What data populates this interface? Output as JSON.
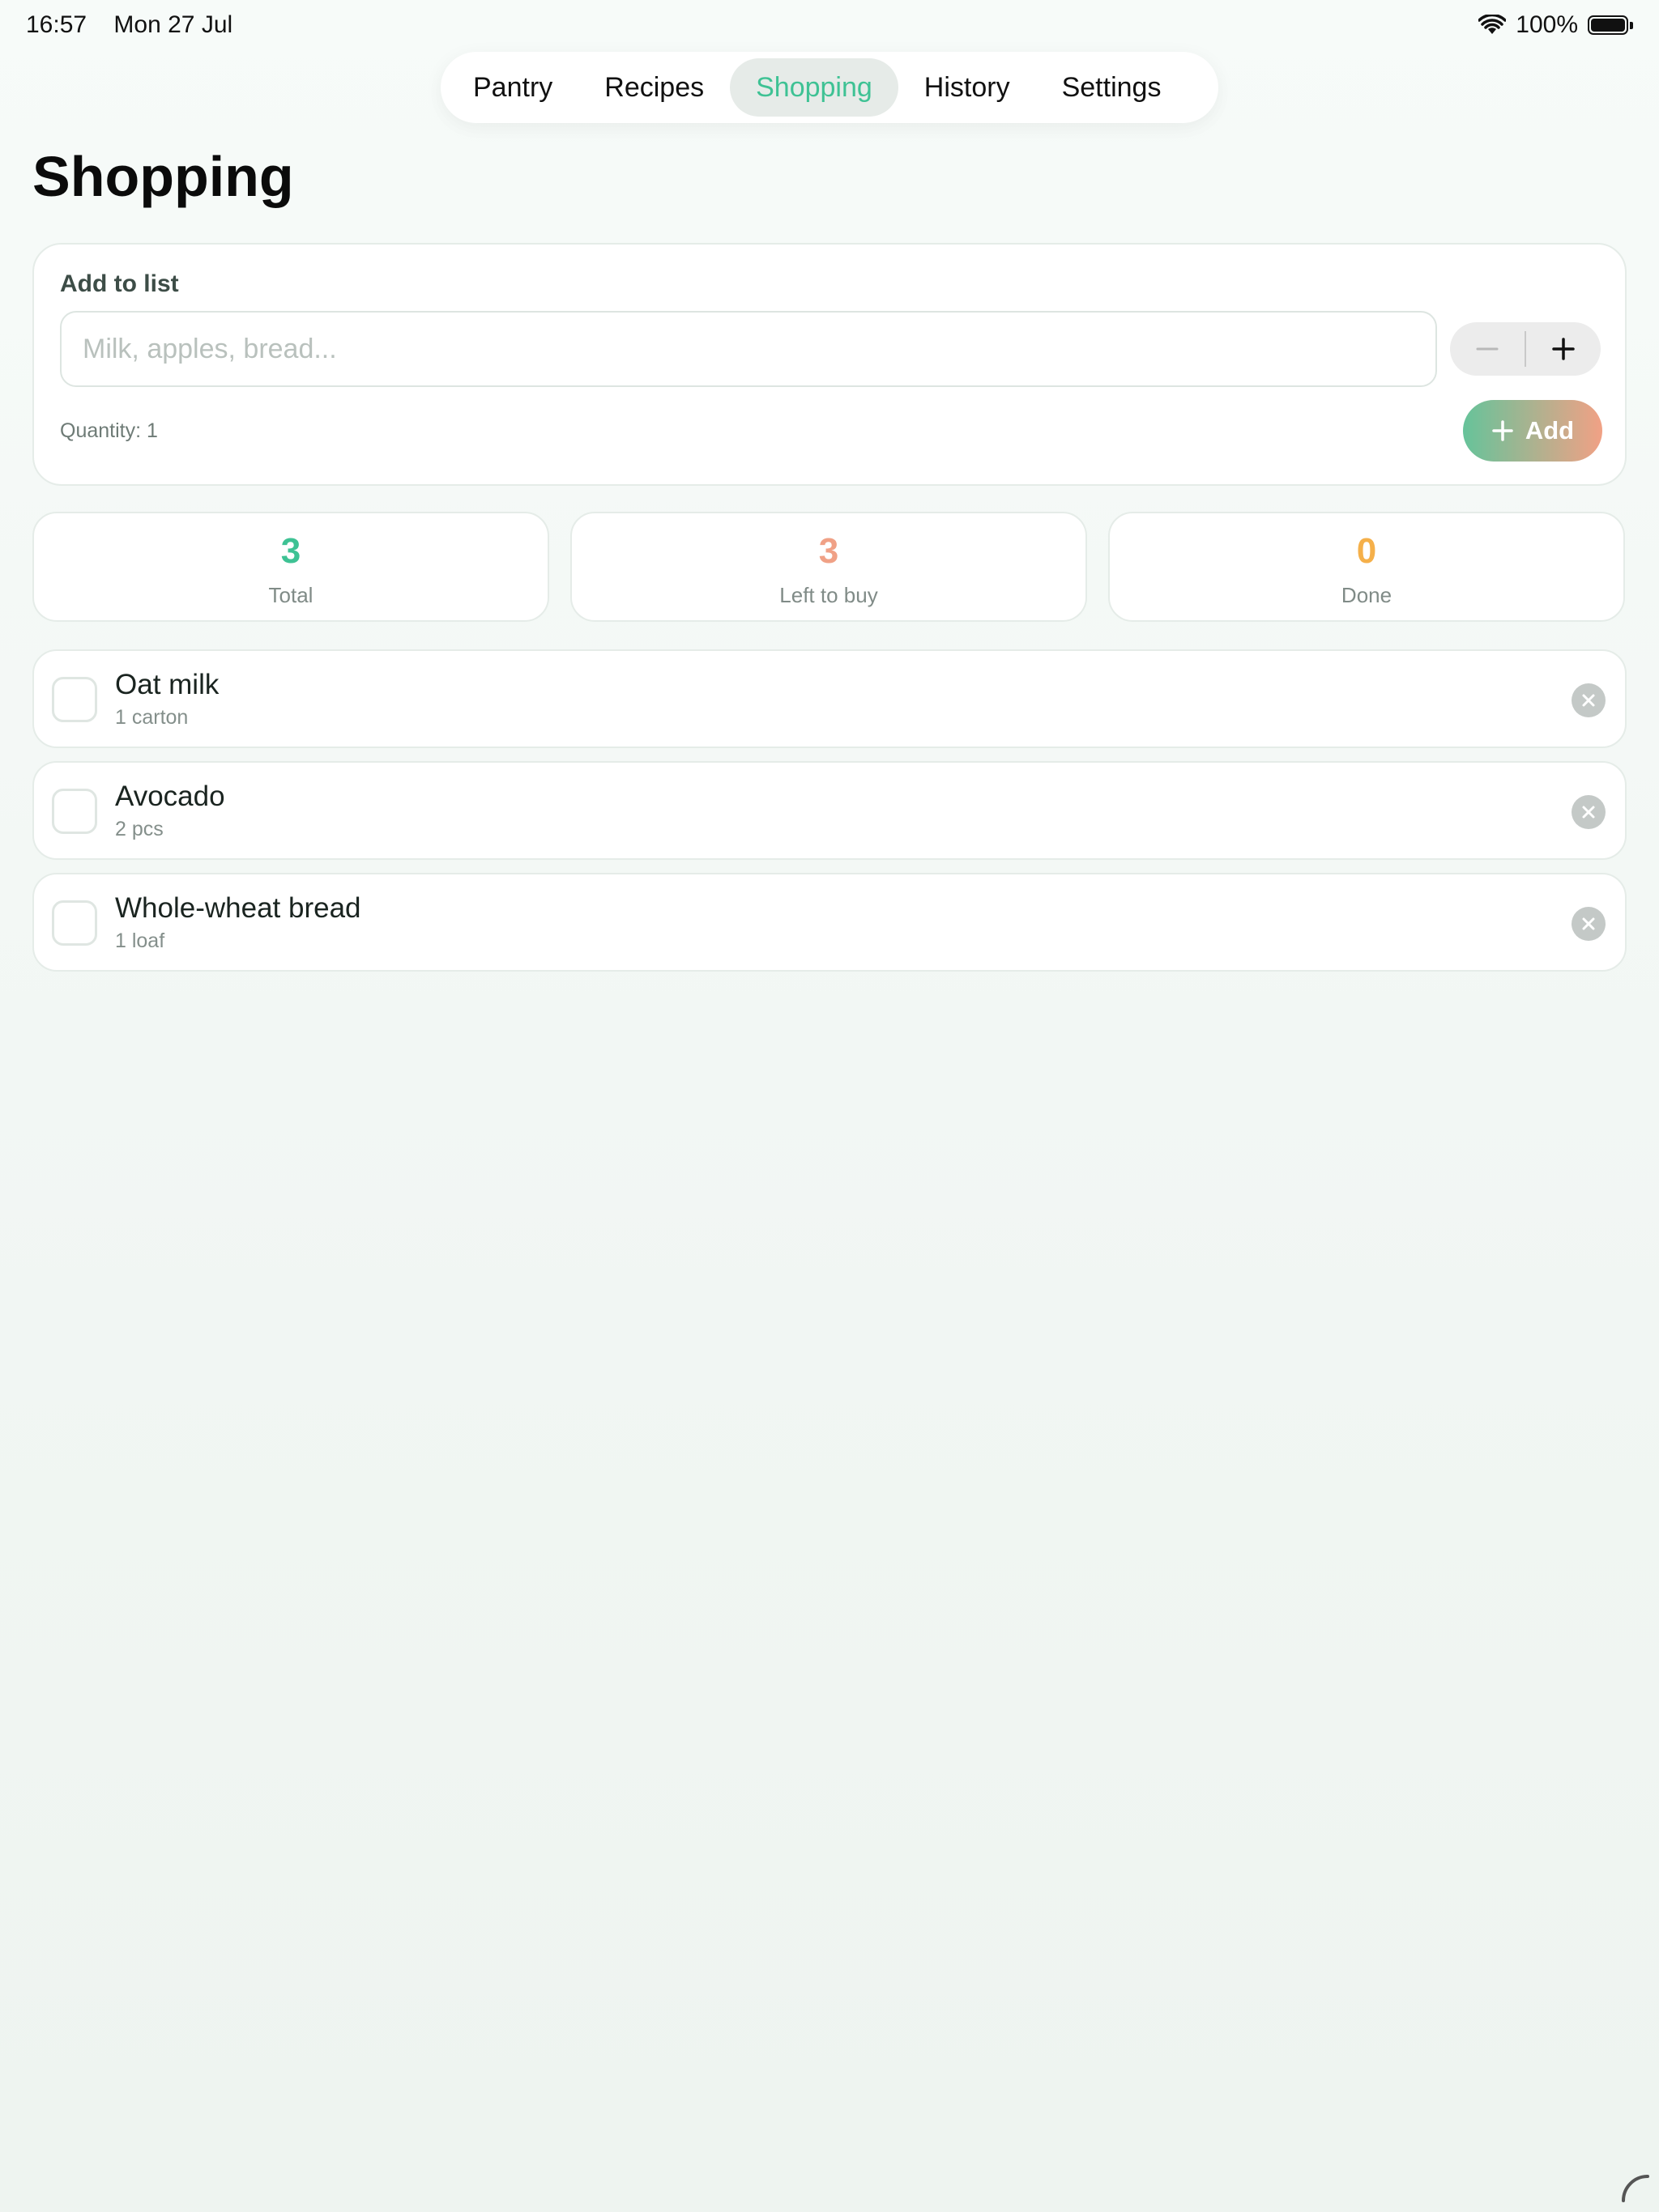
{
  "status_bar": {
    "time": "16:57",
    "date": "Mon 27 Jul",
    "battery": "100%"
  },
  "tabs": [
    {
      "label": "Pantry"
    },
    {
      "label": "Recipes"
    },
    {
      "label": "Shopping"
    },
    {
      "label": "History"
    },
    {
      "label": "Settings"
    }
  ],
  "active_tab": "Shopping",
  "page_title": "Shopping",
  "add_form": {
    "label": "Add to list",
    "input_value": "",
    "placeholder": "Milk, apples, bread...",
    "quantity_text": "Quantity: 1",
    "add_label": "Add"
  },
  "stats": [
    {
      "value": "3",
      "label": "Total",
      "color": "#3ec294"
    },
    {
      "value": "3",
      "label": "Left to buy",
      "color": "#f0a186"
    },
    {
      "value": "0",
      "label": "Done",
      "color": "#f5b04a"
    }
  ],
  "items": [
    {
      "name": "Oat milk",
      "qty": "1 carton",
      "checked": false
    },
    {
      "name": "Avocado",
      "qty": "2 pcs",
      "checked": false
    },
    {
      "name": "Whole-wheat bread",
      "qty": "1 loaf",
      "checked": false
    }
  ],
  "colors": {
    "accent": "#3ec294",
    "button_gradient_start": "#66c39a",
    "button_gradient_end": "#f1a185"
  },
  "icons": {
    "wifi": "wifi-icon",
    "battery": "battery-icon",
    "decrement": "minus-icon",
    "increment": "plus-icon",
    "add": "plus-icon",
    "remove": "close-icon",
    "resize": "resize-handle-icon"
  }
}
